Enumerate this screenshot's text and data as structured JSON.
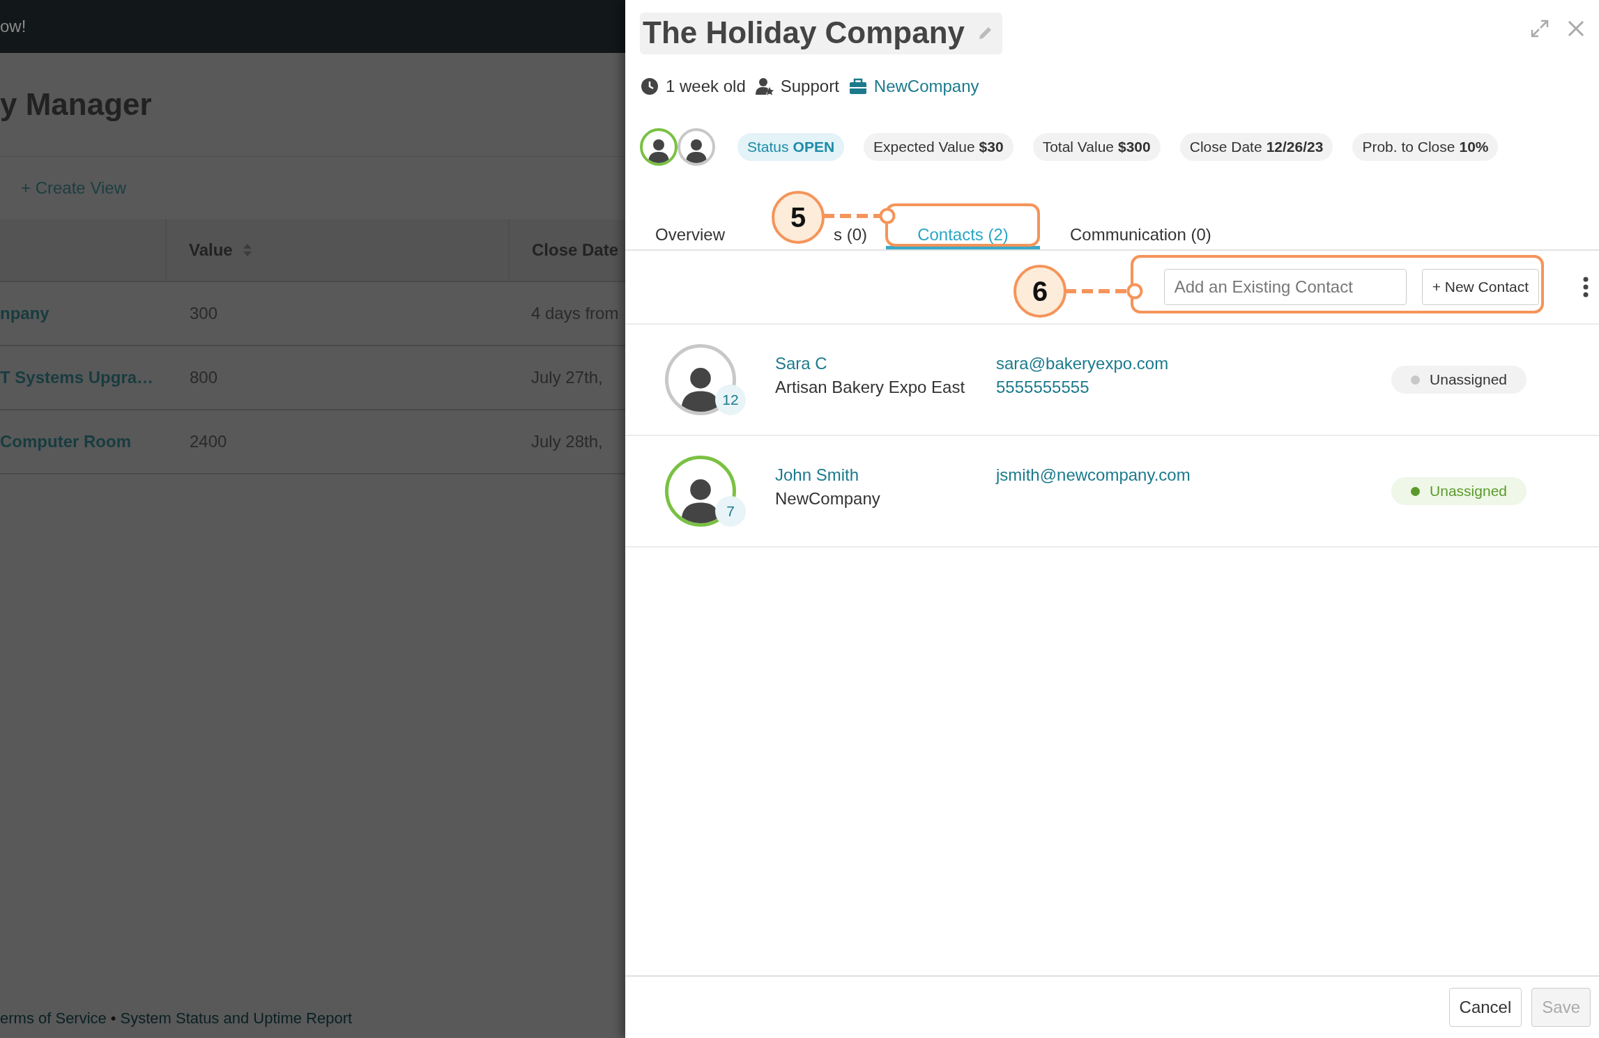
{
  "background": {
    "banner": "ow!",
    "title": "y Manager",
    "create_view": "+ Create View",
    "table": {
      "columns": [
        {
          "label": "Value",
          "sortable": true
        },
        {
          "label": "Close Date",
          "sortable": false
        }
      ],
      "rows": [
        {
          "name": "npany",
          "value": "300",
          "close_date": "4 days from"
        },
        {
          "name": "T Systems Upgra…",
          "value": "800",
          "close_date": "July 27th,"
        },
        {
          "name": "Computer Room",
          "value": "2400",
          "close_date": "July 28th,"
        }
      ]
    },
    "footer": {
      "links": [
        "erms of Service",
        "System Status and Uptime Report"
      ],
      "separator": "•"
    }
  },
  "panel": {
    "title": "The Holiday Company",
    "meta": [
      {
        "kind": "age",
        "label": "1 week old",
        "link": false
      },
      {
        "kind": "team",
        "label": "Support",
        "link": false
      },
      {
        "kind": "company",
        "label": "NewCompany",
        "link": true
      }
    ],
    "avatars": [
      {
        "color": "#7ac143"
      },
      {
        "color": "#c8c8c8"
      }
    ],
    "chips": [
      {
        "kind": "status",
        "label": "Status",
        "value": "OPEN"
      },
      {
        "kind": "plain",
        "label": "Expected Value",
        "value": "$30"
      },
      {
        "kind": "plain",
        "label": "Total Value",
        "value": "$300"
      },
      {
        "kind": "plain",
        "label": "Close Date",
        "value": "12/26/23"
      },
      {
        "kind": "plain",
        "label": "Prob. to Close",
        "value": "10%"
      }
    ],
    "tabs": [
      {
        "label": "Overview",
        "selected": false
      },
      {
        "label": "s (0)",
        "selected": false
      },
      {
        "label": "Contacts (2)",
        "selected": true
      },
      {
        "label": "Communication (0)",
        "selected": false
      }
    ],
    "toolbar": {
      "search": {
        "placeholder": "Add an Existing Contact"
      },
      "new_button": "+ New Contact"
    },
    "contacts": [
      {
        "name": "Sara C",
        "company": "Artisan Bakery Expo East",
        "email": "sara@bakeryexpo.com",
        "phone": "5555555555",
        "count": "12",
        "avatar": {
          "color": "#c8c8c8"
        },
        "status": {
          "label": "Unassigned",
          "color": "#c8c8c8",
          "active": false
        }
      },
      {
        "name": "John Smith",
        "company": "NewCompany",
        "email": "jsmith@newcompany.com",
        "count": "7",
        "avatar": {
          "color": "#7ac143"
        },
        "status": {
          "label": "Unassigned",
          "color": "#5b9a2a",
          "active": true
        }
      }
    ],
    "buttons": [
      {
        "label": "Cancel",
        "disabled": false
      },
      {
        "label": "Save",
        "disabled": true
      }
    ]
  },
  "callouts": [
    {
      "number": "5"
    },
    {
      "number": "6"
    }
  ]
}
